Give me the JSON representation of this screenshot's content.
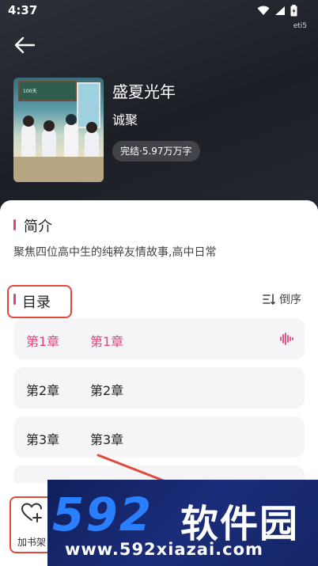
{
  "status_bar": {
    "time": "4:37",
    "sub_label": "eti5"
  },
  "book": {
    "title": "盛夏光年",
    "author": "诚聚",
    "status": "完结·5.97万万字",
    "cover_board_text": "100天"
  },
  "intro": {
    "heading": "简介",
    "text": "聚焦四位高中生的纯粹友情故事,高中日常"
  },
  "toc": {
    "heading": "目录",
    "sort_label": "倒序",
    "chapters": [
      {
        "num": "第1章",
        "title": "第1章",
        "active": true
      },
      {
        "num": "第2章",
        "title": "第2章",
        "active": false
      },
      {
        "num": "第3章",
        "title": "第3章",
        "active": false
      }
    ]
  },
  "bottom": {
    "shelf_label": "加书架"
  },
  "watermark": {
    "brand_num": "592",
    "brand_cn": "软件园",
    "url": "www.592xiazai.com"
  },
  "colors": {
    "accent": "#e0457a",
    "highlight": "#e14a3a",
    "watermark_bg": "#1b2d7a"
  }
}
